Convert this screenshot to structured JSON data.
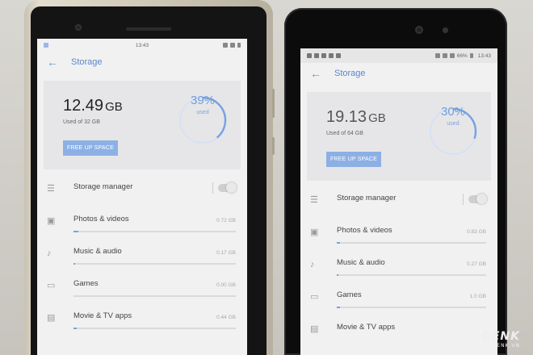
{
  "left_phone": {
    "status_time": "13:43",
    "title": "Storage",
    "used_value": "12.49",
    "used_unit": "GB",
    "used_of": "Used of 32 GB",
    "free_button": "FREE UP SPACE",
    "ring_percent": "39%",
    "ring_label": "used",
    "ring_fraction": 0.39,
    "items": [
      {
        "label": "Storage manager",
        "size": "",
        "icon": "list-icon"
      },
      {
        "label": "Photos & videos",
        "size": "0.72 GB",
        "icon": "image-icon",
        "fraction": 0.03
      },
      {
        "label": "Music & audio",
        "size": "0.17 GB",
        "icon": "music-note-icon",
        "fraction": 0.01
      },
      {
        "label": "Games",
        "size": "0.00 GB",
        "icon": "gamepad-icon",
        "fraction": 0.0
      },
      {
        "label": "Movie & TV apps",
        "size": "0.44 GB",
        "icon": "film-icon",
        "fraction": 0.02
      }
    ]
  },
  "right_phone": {
    "status_time": "13:43",
    "battery": "66%",
    "title": "Storage",
    "used_value": "19.13",
    "used_unit": "GB",
    "used_of": "Used of 64 GB",
    "free_button": "FREE UP SPACE",
    "ring_percent": "30%",
    "ring_label": "used",
    "ring_fraction": 0.3,
    "items": [
      {
        "label": "Storage manager",
        "size": "",
        "icon": "list-icon"
      },
      {
        "label": "Photos & videos",
        "size": "0.83 GB",
        "icon": "image-icon",
        "fraction": 0.02
      },
      {
        "label": "Music & audio",
        "size": "0.27 GB",
        "icon": "music-note-icon",
        "fraction": 0.01
      },
      {
        "label": "Games",
        "size": "1.0 GB",
        "icon": "gamepad-icon",
        "fraction": 0.02
      },
      {
        "label": "Movie & TV apps",
        "size": "",
        "icon": "film-icon",
        "fraction": 0.0
      }
    ]
  },
  "watermark": {
    "brand": "GENK",
    "site": "GENK.VN"
  },
  "colors": {
    "accent": "#6f9de0",
    "button": "#8db0e4"
  }
}
